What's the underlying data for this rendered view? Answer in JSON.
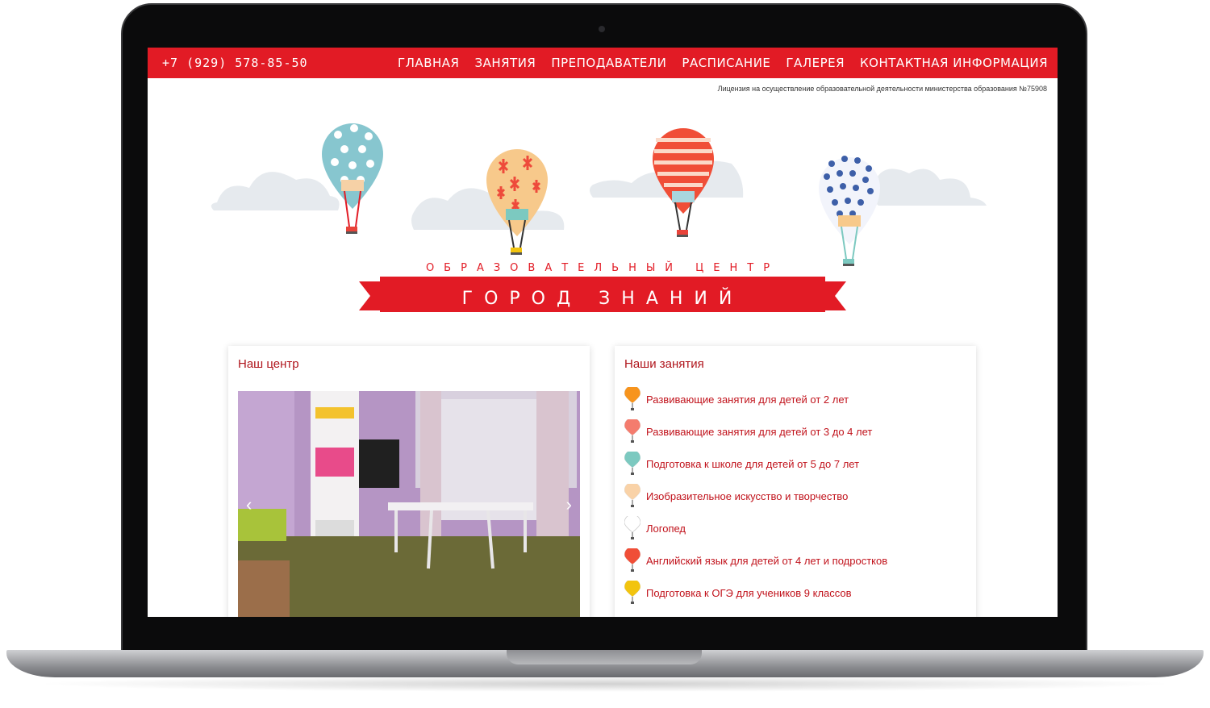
{
  "topbar": {
    "phone": "+7 (929) 578-85-50",
    "nav": [
      "ГЛАВНАЯ",
      "ЗАНЯТИЯ",
      "ПРЕПОДАВАТЕЛИ",
      "РАСПИСАНИЕ",
      "ГАЛЕРЕЯ",
      "КОНТАКТНАЯ ИНФОРМАЦИЯ"
    ]
  },
  "license": "Лицензия на осуществление образовательной деятельности министерства образования №75908",
  "hero": {
    "subtitle": "ОБРАЗОВАТЕЛЬНЫЙ ЦЕНТР",
    "title": "ГОРОД ЗНАНИЙ"
  },
  "center_card": {
    "title": "Наш центр",
    "prev_arrow": "‹",
    "next_arrow": "›"
  },
  "classes_card": {
    "title": "Наши занятия",
    "items": [
      {
        "label": "Развивающие занятия для детей от 2 лет",
        "color": "#f7941d"
      },
      {
        "label": "Развивающие занятия для детей от 3 до 4 лет",
        "color": "#f47c6e"
      },
      {
        "label": "Подготовка к школе для детей от 5 до 7 лет",
        "color": "#7cc9c0"
      },
      {
        "label": "Изобразительное искусство и творчество",
        "color": "#f9d2a7"
      },
      {
        "label": "Логопед",
        "color": "#ffffff"
      },
      {
        "label": "Английский язык для детей от 4 лет и подростков",
        "color": "#f04e37"
      },
      {
        "label": "Подготовка к ОГЭ для учеников 9 классов",
        "color": "#f2c40f"
      }
    ]
  },
  "colors": {
    "brand_red": "#e21b25",
    "text_red": "#c1121b"
  }
}
